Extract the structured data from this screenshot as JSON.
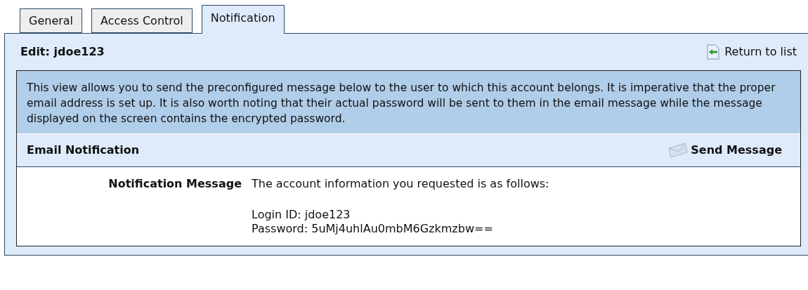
{
  "tabs": [
    {
      "label": "General",
      "selected": false
    },
    {
      "label": "Access Control",
      "selected": false
    },
    {
      "label": "Notification",
      "selected": true
    }
  ],
  "header": {
    "title": "Edit: jdoe123",
    "return_link": "Return to list"
  },
  "description": "This view allows you to send the preconfigured message below to the user to which this account belongs. It is imperative that the proper email address is set up. It is also worth noting that their actual password will be sent to them in the email message while the message displayed on the screen contains the encrypted password.",
  "section": {
    "title": "Email Notification",
    "action": "Send Message"
  },
  "fields": [
    {
      "label": "Notification Message",
      "intro": "The account information you requested is as follows:",
      "details": [
        "Login ID: jdoe123",
        "Password: 5uMj4uhlAu0mbM6Gzkmzbw=="
      ]
    }
  ]
}
